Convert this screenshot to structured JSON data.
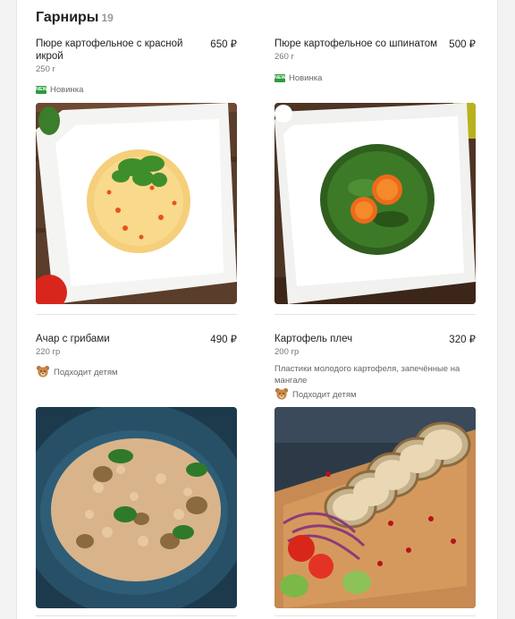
{
  "section": {
    "title": "Гарниры",
    "count": "19"
  },
  "items": [
    {
      "name": "Пюре картофельное с красной икрой",
      "price": "650 ₽",
      "weight": "250 г",
      "tag_label": "Новинка",
      "tag_icon": "new-badge-icon",
      "new_badge_text": "NEW",
      "photo": "mashed-potato-with-red-caviar-photo"
    },
    {
      "name": "Пюре картофельное со шпинатом",
      "price": "500 ₽",
      "weight": "260 г",
      "tag_label": "Новинка",
      "tag_icon": "new-badge-icon",
      "new_badge_text": "NEW",
      "photo": "mashed-potato-with-spinach-photo"
    },
    {
      "name": "Ачар с грибами",
      "price": "490 ₽",
      "weight": "220 гр",
      "tag_label": "Подходит детям",
      "tag_icon": "bear-icon",
      "photo": "achar-with-mushrooms-photo"
    },
    {
      "name": "Картофель плеч",
      "price": "320 ₽",
      "weight": "200 гр",
      "description": "Пластики молодого картофеля, запечённые на мангале",
      "tag_label": "Подходит детям",
      "tag_icon": "bear-icon",
      "photo": "grilled-potato-slices-photo"
    }
  ],
  "colors": {
    "new_badge": "#2e9b3c",
    "price": "#222222",
    "muted": "#777777"
  }
}
